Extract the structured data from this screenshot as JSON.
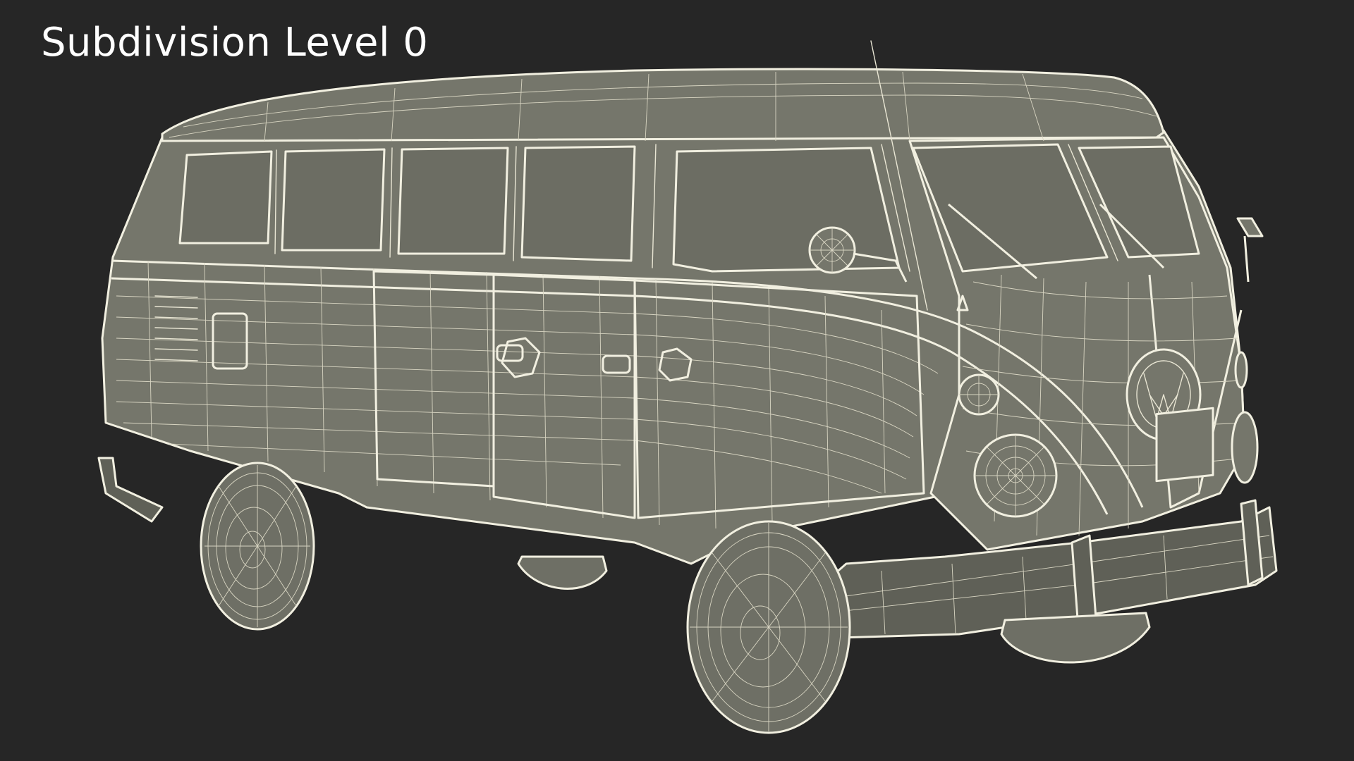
{
  "title": "Subdivision Level 0",
  "colors": {
    "background": "#262626",
    "model_surface": "#75766b",
    "wireframe": "#e9e6d4",
    "title_text": "#ffffff"
  },
  "subject": "vw-bus-wireframe"
}
